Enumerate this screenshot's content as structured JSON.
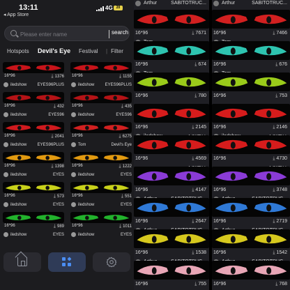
{
  "status": {
    "time": "13:11",
    "back": "◂ App Store",
    "network": "4G",
    "battery": "20"
  },
  "search": {
    "placeholder": "Please enter name",
    "button": "search"
  },
  "tabs": {
    "items": [
      "Hotspots",
      "Devil's Eye",
      "Festival"
    ],
    "active": "Devil's Eye",
    "filter": "Filter"
  },
  "left_cards": [
    {
      "size": "16*96",
      "downloads": "1376",
      "author": "iledshow",
      "tag": "EYES96PLUS",
      "color": "#c8141a"
    },
    {
      "size": "16*96",
      "downloads": "1155",
      "author": "iledshow",
      "tag": "EYES96PLUS",
      "color": "#c8141a"
    },
    {
      "size": "16*96",
      "downloads": "432",
      "author": "iledshow",
      "tag": "EYES96",
      "color": "#b51316"
    },
    {
      "size": "16*96",
      "downloads": "435",
      "author": "iledshow",
      "tag": "EYES96",
      "color": "#b51316"
    },
    {
      "size": "16*96",
      "downloads": "2041",
      "author": "iledshow",
      "tag": "EYES96PLUS",
      "color": "#d01a1e"
    },
    {
      "size": "16*96",
      "downloads": "6275",
      "author": "Tom",
      "tag": "Devil's Eye",
      "color": "#d22020"
    },
    {
      "size": "16*96",
      "downloads": "1398",
      "author": "iledshow",
      "tag": "EYES",
      "color": "#e29a10"
    },
    {
      "size": "16*96",
      "downloads": "1222",
      "author": "iledshow",
      "tag": "EYES",
      "color": "#e29a10"
    },
    {
      "size": "16*96",
      "downloads": "573",
      "author": "iledshow",
      "tag": "EYES",
      "color": "#c9d21a"
    },
    {
      "size": "16*96",
      "downloads": "551",
      "author": "iledshow",
      "tag": "EYES",
      "color": "#c9d21a"
    },
    {
      "size": "16*96",
      "downloads": "989",
      "author": "iledshow",
      "tag": "EYES",
      "color": "#22b32c"
    },
    {
      "size": "16*96",
      "downloads": "1011",
      "author": "iledshow",
      "tag": "EYES",
      "color": "#22b32c"
    }
  ],
  "bottom_nav": {
    "home": "home-icon",
    "templates": "grid-icon",
    "settings": "gear-icon"
  },
  "mid_column": {
    "top": {
      "author": "Arthur",
      "tag": "SABITOTRUC..."
    },
    "cards": [
      {
        "size": "16*96",
        "downloads": "7671",
        "author": "Tom",
        "tag": "",
        "color": "#d22020"
      },
      {
        "size": "16*96",
        "downloads": "674",
        "author": "Tom",
        "tag": "",
        "color": "#2ec4b0"
      },
      {
        "size": "16*96",
        "downloads": "780",
        "author": "",
        "tag": "",
        "color": "#9acb1a"
      },
      {
        "size": "16*96",
        "downloads": "2145",
        "author": "iledshow",
        "tag": "全彩高针",
        "color": "#d61c1c"
      },
      {
        "size": "16*96",
        "downloads": "4569",
        "author": "",
        "tag": "全彩高针",
        "color": "#d61c1c"
      },
      {
        "size": "16*96",
        "downloads": "4147",
        "author": "Arthur",
        "tag": "SABITOTRUC...",
        "color": "#8a3bd6"
      },
      {
        "size": "16*96",
        "downloads": "2647",
        "author": "Arthur",
        "tag": "SABITOTRUC...",
        "color": "#2f79d6"
      },
      {
        "size": "16*96",
        "downloads": "1538",
        "author": "Arthur",
        "tag": "SABITOTRUC...",
        "color": "#d6c81e"
      },
      {
        "size": "16*96",
        "downloads": "755",
        "author": "",
        "tag": "",
        "color": "#e8a6b6"
      }
    ]
  },
  "right_column": {
    "top": {
      "author": "Arthur",
      "tag": "SABITOTRUC..."
    },
    "cards": [
      {
        "size": "16*96",
        "downloads": "7466",
        "author": "Tom",
        "tag": "",
        "color": "#d22020"
      },
      {
        "size": "16*96",
        "downloads": "676",
        "author": "Tom",
        "tag": "",
        "color": "#2ec4b0"
      },
      {
        "size": "16*96",
        "downloads": "753",
        "author": "",
        "tag": "",
        "color": "#9acb1a"
      },
      {
        "size": "16*96",
        "downloads": "2146",
        "author": "iledshow",
        "tag": "全彩高针",
        "color": "#d61c1c"
      },
      {
        "size": "16*96",
        "downloads": "4730",
        "author": "",
        "tag": "全彩高针",
        "color": "#d61c1c"
      },
      {
        "size": "16*96",
        "downloads": "3748",
        "author": "Arthur",
        "tag": "SABITOTRUC...",
        "color": "#8a3bd6"
      },
      {
        "size": "16*96",
        "downloads": "2719",
        "author": "Arthur",
        "tag": "SABITOTRUC...",
        "color": "#2f79d6"
      },
      {
        "size": "16*96",
        "downloads": "1542",
        "author": "Arthur",
        "tag": "SABITOTRUC...",
        "color": "#d6c81e"
      },
      {
        "size": "16*96",
        "downloads": "768",
        "author": "",
        "tag": "",
        "color": "#e8a6b6"
      }
    ]
  }
}
